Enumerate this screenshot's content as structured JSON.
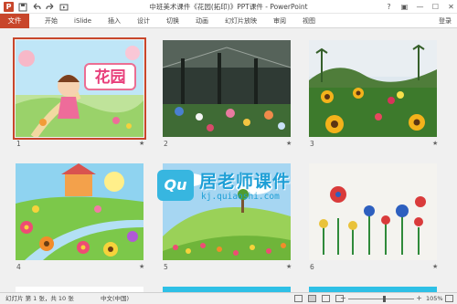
{
  "window": {
    "title": "中班美术课件《花园(拓印)》PPT课件 - PowerPoint",
    "app_icon": "P",
    "controls": [
      "?",
      "▣",
      "—",
      "☐",
      "✕"
    ]
  },
  "quick_access": [
    {
      "icon": "save-icon"
    },
    {
      "icon": "undo-icon"
    },
    {
      "icon": "redo-icon"
    },
    {
      "icon": "start-from-beginning-icon"
    }
  ],
  "ribbon": {
    "file": "文件",
    "tabs": [
      "开始",
      "iSlide",
      "插入",
      "设计",
      "切换",
      "动画",
      "幻灯片放映",
      "审阅",
      "视图"
    ],
    "login": "登录"
  },
  "slides": [
    {
      "number": "1",
      "title": "花园",
      "selected": true,
      "has_transition_star": true
    },
    {
      "number": "2",
      "selected": false,
      "has_transition_star": true
    },
    {
      "number": "3",
      "selected": false,
      "has_transition_star": true
    },
    {
      "number": "4",
      "selected": false,
      "has_transition_star": true
    },
    {
      "number": "5",
      "selected": false,
      "has_transition_star": true
    },
    {
      "number": "6",
      "selected": false,
      "has_transition_star": true
    }
  ],
  "transition_star": "★",
  "watermark": {
    "logo": "Qu",
    "title": "居老师课件",
    "url": "kj.quiaoshi.com"
  },
  "status": {
    "slide_info": "幻灯片 第 1 张，共 10 张",
    "language": "中文(中国)",
    "zoom_minus": "−",
    "zoom_plus": "+",
    "zoom": "105%",
    "zoom_level": 0.55
  }
}
